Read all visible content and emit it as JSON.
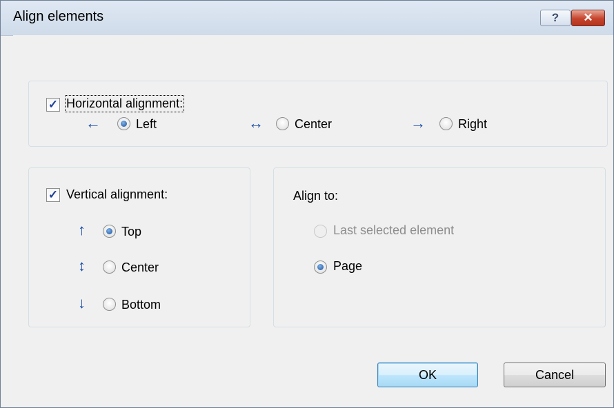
{
  "window": {
    "title": "Align elements",
    "help_label": "?",
    "close_label": "✕"
  },
  "horizontal": {
    "checkbox_label": "Horizontal alignment:",
    "checked": true,
    "options": [
      {
        "label": "Left",
        "arrow": "←",
        "selected": true
      },
      {
        "label": "Center",
        "arrow": "↔",
        "selected": false
      },
      {
        "label": "Right",
        "arrow": "→",
        "selected": false
      }
    ]
  },
  "vertical": {
    "checkbox_label": "Vertical alignment:",
    "checked": true,
    "options": [
      {
        "label": "Top",
        "arrow": "↑",
        "selected": true
      },
      {
        "label": "Center",
        "arrow": "↕",
        "selected": false
      },
      {
        "label": "Bottom",
        "arrow": "↓",
        "selected": false
      }
    ]
  },
  "align_to": {
    "title": "Align to:",
    "options": [
      {
        "label": "Last selected element",
        "selected": false,
        "disabled": true
      },
      {
        "label": "Page",
        "selected": true,
        "disabled": false
      }
    ]
  },
  "buttons": {
    "ok": "OK",
    "cancel": "Cancel"
  },
  "colors": {
    "arrow": "#1a4ea8",
    "titlebar": "#d6e1ef",
    "close": "#c6432c"
  }
}
